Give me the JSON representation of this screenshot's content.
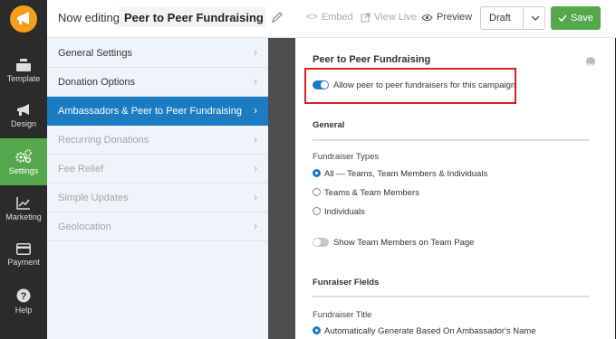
{
  "header": {
    "editing_label": "Now editing",
    "campaign_title": "Peer to Peer Fundraising",
    "embed": "Embed",
    "view_live": "View Live",
    "preview": "Preview",
    "status": "Draft",
    "save": "Save",
    "accent": "#54a84b"
  },
  "leftnav": {
    "items": [
      {
        "label": "Template",
        "icon": "template-icon"
      },
      {
        "label": "Design",
        "icon": "megaphone-icon"
      },
      {
        "label": "Settings",
        "icon": "gears-icon",
        "active": true
      },
      {
        "label": "Marketing",
        "icon": "chart-icon"
      },
      {
        "label": "Payment",
        "icon": "card-icon"
      },
      {
        "label": "Help",
        "icon": "help-icon"
      }
    ]
  },
  "settings_menu": {
    "items": [
      {
        "label": "General Settings",
        "state": "normal"
      },
      {
        "label": "Donation Options",
        "state": "normal"
      },
      {
        "label": "Ambassadors & Peer to Peer Fundraising",
        "state": "active"
      },
      {
        "label": "Recurring Donations",
        "state": "disabled"
      },
      {
        "label": "Fee Relief",
        "state": "disabled"
      },
      {
        "label": "Simple Updates",
        "state": "disabled"
      },
      {
        "label": "Geolocation",
        "state": "disabled"
      }
    ],
    "active_color": "#1b7cc2"
  },
  "content": {
    "title": "Peer to Peer Fundraising",
    "allow_toggle": {
      "label": "Allow peer to peer fundraisers for this campaign",
      "on": true
    },
    "general_heading": "General",
    "fundraiser_types_label": "Fundraiser Types",
    "fundraiser_types": [
      {
        "label": "All — Teams, Team Members & Individuals",
        "checked": true
      },
      {
        "label": "Teams & Team Members",
        "checked": false
      },
      {
        "label": "Individuals",
        "checked": false
      }
    ],
    "show_team_toggle": {
      "label": "Show Team Members on Team Page",
      "on": false
    },
    "fundraiser_fields_heading": "Funraiser Fields",
    "fundraiser_title_label": "Fundraiser Title",
    "fundraiser_title_option": {
      "label": "Automatically Generate Based On Ambassador's Name",
      "checked": true
    }
  }
}
